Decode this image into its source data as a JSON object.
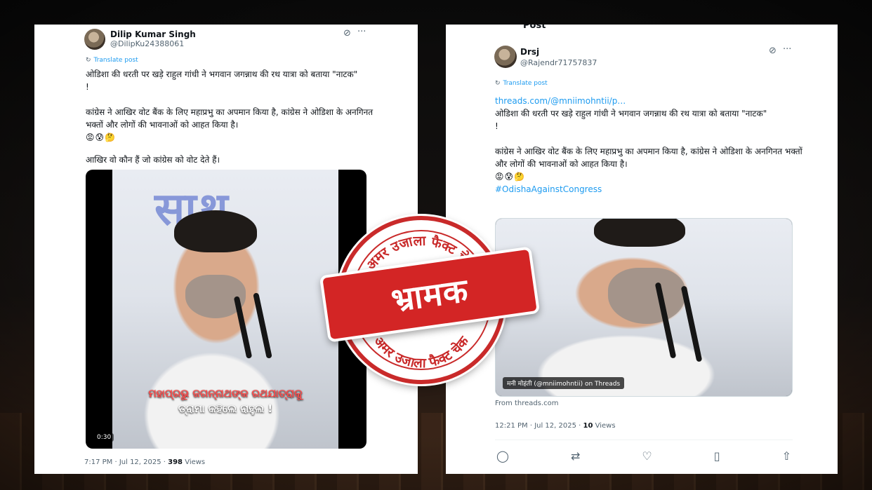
{
  "left_post": {
    "author_name": "Dilip Kumar Singh",
    "author_handle": "@DilipKu24388061",
    "grok_icon": "grok-icon",
    "more_icon": "more-icon",
    "translate_label": "Translate post",
    "paragraph1": "ओडिशा की धरती पर खड़े राहुल गांधी ने भगवान जगन्नाथ की रथ यात्रा को बताया \"नाटक\"\n!",
    "paragraph2": "कांग्रेस ने आखिर वोट बैंक के लिए महाप्रभु का अपमान किया है, कांग्रेस ने ओडिशा के अनगिनत भक्तों और लोगों की भावनाओं को आहत किया है।",
    "emojis": "😡😰🤔",
    "paragraph3": "आखिर वो कौन हैं जो कांग्रेस को वोट देते हैं।",
    "video_caption_line1": "ମହାପ୍ରଭୁ ଜଗନ୍ନାଥଙ୍କ ରଥଯାତ୍ରାକୁ",
    "video_caption_line2": "ଡ୍ରାମା କହିଲେ ରାହୁଲ !",
    "video_duration": "0:30",
    "timestamp": "7:17 PM · Jul 12, 2025 · ",
    "views_count": "398",
    "views_label": " Views"
  },
  "right_post": {
    "top_partial_label": "Post",
    "author_name": "Drsj",
    "author_handle": "@Rajendr71757837",
    "grok_icon": "grok-icon",
    "more_icon": "more-icon",
    "translate_label": "Translate post",
    "link_text": "threads.com/@mniimohntii/p…",
    "paragraph1": "ओडिशा की धरती पर खड़े राहुल गांधी ने भगवान जगन्नाथ की रथ यात्रा को बताया \"नाटक\"\n!",
    "paragraph2": "कांग्रेस ने आखिर वोट बैंक के लिए महाप्रभु का अपमान किया है, कांग्रेस ने ओडिशा के अनगिनत भक्तों और लोगों की भावनाओं को आहत किया है।",
    "emojis": "😡😰🤔",
    "hashtag": "#OdishaAgainstCongress",
    "media_tag": "मनी मोहंती (@mniimohntii) on Threads",
    "from_label": "From threads.com",
    "timestamp": "12:21 PM · Jul 12, 2025 · ",
    "views_count": "10",
    "views_label": " Views",
    "actions": [
      "reply-icon",
      "retweet-icon",
      "like-icon",
      "bookmark-icon",
      "share-icon"
    ]
  },
  "stamp": {
    "top_text": "अमर उजाला फैक्ट चेक",
    "bottom_text": "अमर उजाला फैक्ट चेक",
    "verdict": "भ्रामक",
    "colors": {
      "red": "#d32525",
      "white": "#ffffff"
    }
  }
}
